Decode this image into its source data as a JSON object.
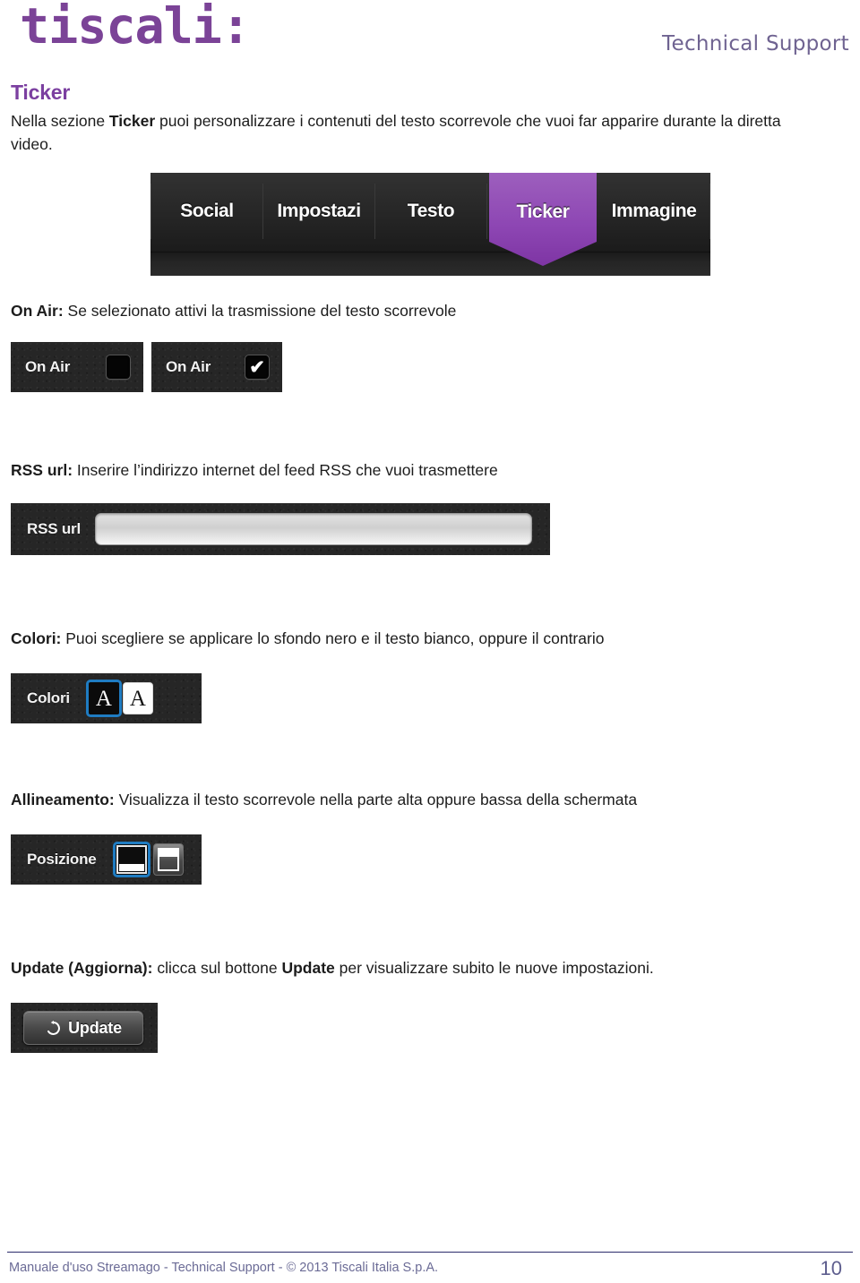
{
  "header": {
    "brand": "tiscali:",
    "support_label": "Technical Support",
    "brand_color": "#7b4397",
    "support_color": "#6f6391"
  },
  "section": {
    "heading": "Ticker",
    "heading_color": "#7b3fa0",
    "intro_prefix": "Nella sezione ",
    "intro_bold": "Ticker",
    "intro_suffix": " puoi personalizzare i contenuti del testo scorrevole che vuoi far apparire durante la diretta video."
  },
  "tabbar": {
    "tabs": [
      {
        "label": "Social",
        "active": false
      },
      {
        "label": "Impostazi",
        "active": false
      },
      {
        "label": "Testo",
        "active": false
      },
      {
        "label": "Ticker",
        "active": true
      },
      {
        "label": "Immagine",
        "active": false
      }
    ],
    "active_color": "#8e47b4"
  },
  "onair": {
    "desc_bold": "On Air:",
    "desc_rest": " Se selezionato attivi la trasmissione del testo scorrevole",
    "widget_off": {
      "label": "On Air",
      "checked": false,
      "tick": ""
    },
    "widget_on": {
      "label": "On Air",
      "checked": true,
      "tick": "✔"
    }
  },
  "rss": {
    "desc_bold": "RSS url:",
    "desc_rest": " Inserire l’indirizzo internet del feed RSS che vuoi trasmettere",
    "label": "RSS url",
    "value": "",
    "placeholder": ""
  },
  "colori": {
    "desc_bold": "Colori:",
    "desc_rest": " Puoi scegliere se applicare lo sfondo nero e il testo bianco, oppure il contrario",
    "label": "Colori",
    "options": [
      {
        "glyph": "A",
        "style": "black-background-white-text",
        "selected": true
      },
      {
        "glyph": "A",
        "style": "white-background-black-text",
        "selected": false
      }
    ],
    "selected_border_color": "#1f7cc2"
  },
  "posizione": {
    "desc_bold": "Allineamento:",
    "desc_rest": " Visualizza il testo scorrevole nella parte alta oppure bassa della schermata",
    "label": "Posizione",
    "options": [
      {
        "icon": "ticker-bottom-icon",
        "selected": true
      },
      {
        "icon": "ticker-top-icon",
        "selected": false
      }
    ]
  },
  "update": {
    "desc_bold": "Update (Aggiorna):",
    "desc_mid": " clicca sul bottone ",
    "desc_bold2": "Update",
    "desc_rest": " per visualizzare subito le nuove impostazioni.",
    "button_label": "Update",
    "button_icon": "refresh-icon"
  },
  "footer": {
    "text": "Manuale d'uso Streamago - Technical Support - © 2013 Tiscali Italia S.p.A.",
    "page": "10",
    "rule_color": "#2b2b6b"
  }
}
